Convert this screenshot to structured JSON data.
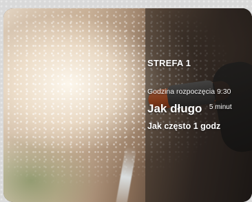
{
  "zone": {
    "title": "STREFA 1",
    "start_time_text": "Godzina rozpoczęcia 9:30",
    "duration_label": "Jak długo",
    "duration_value": "5 minut",
    "frequency_text": "Jak często 1 godz"
  }
}
